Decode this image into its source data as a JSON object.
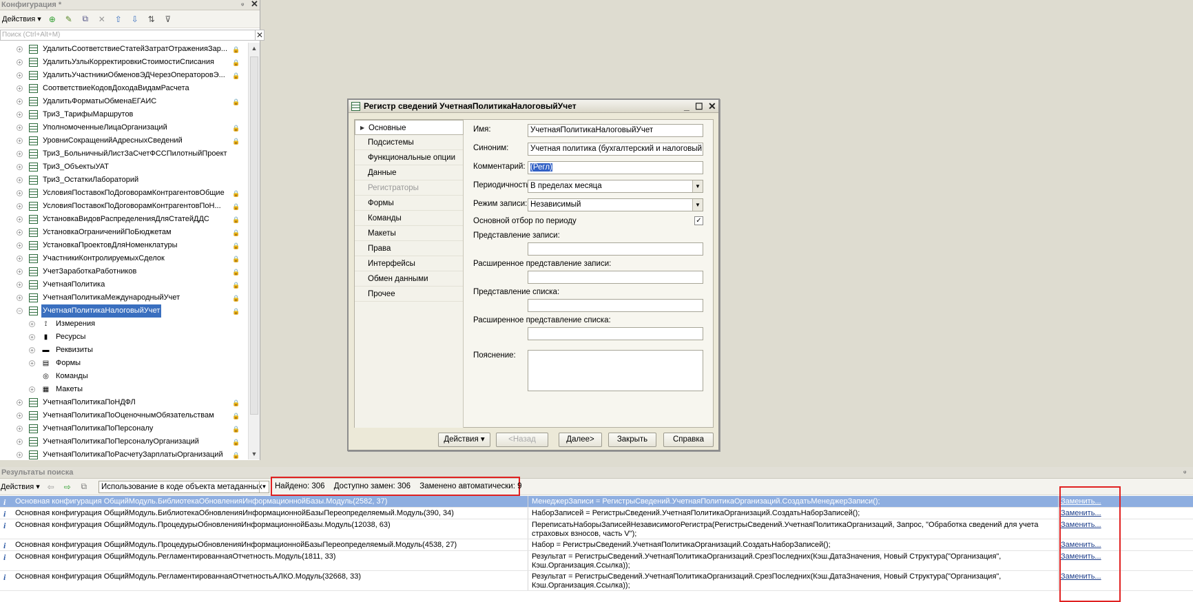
{
  "config": {
    "title": "Конфигурация *",
    "actions_label": "Действия",
    "search_placeholder": "Поиск (Ctrl+Alt+M)",
    "tree_items": [
      {
        "label": "УдалитьСоответствиеСтатейЗатратОтраженияЗар...",
        "lock": true
      },
      {
        "label": "УдалитьУзлыКорректировкиСтоимостиСписания",
        "lock": true
      },
      {
        "label": "УдалитьУчастникиОбменовЭДЧерезОператоровЭ...",
        "lock": true
      },
      {
        "label": "СоответствиеКодовДоходаВидамРасчета",
        "lock": false
      },
      {
        "label": "УдалитьФорматыОбменаЕГАИС",
        "lock": true
      },
      {
        "label": "ТриЗ_ТарифыМаршрутов",
        "lock": false
      },
      {
        "label": "УполномоченныеЛицаОрганизаций",
        "lock": true
      },
      {
        "label": "УровниСокращенийАдресныхСведений",
        "lock": true
      },
      {
        "label": "ТриЗ_БольничныйЛистЗаСчетФССПилотныйПроект",
        "lock": false
      },
      {
        "label": "ТриЗ_ОбъектыУАТ",
        "lock": false
      },
      {
        "label": "ТриЗ_ОстаткиЛабораторий",
        "lock": false
      },
      {
        "label": "УсловияПоставокПоДоговорамКонтрагентовОбщие",
        "lock": true
      },
      {
        "label": "УсловияПоставокПоДоговорамКонтрагентовПоН...",
        "lock": true
      },
      {
        "label": "УстановкаВидовРаспределенияДляСтатейДДС",
        "lock": true
      },
      {
        "label": "УстановкаОграниченийПоБюджетам",
        "lock": true
      },
      {
        "label": "УстановкаПроектовДляНоменклатуры",
        "lock": true
      },
      {
        "label": "УчастникиКонтролируемыхСделок",
        "lock": true
      },
      {
        "label": "УчетЗаработкаРаботников",
        "lock": true
      },
      {
        "label": "УчетнаяПолитика",
        "lock": true
      },
      {
        "label": "УчетнаяПолитикаМеждународныйУчет",
        "lock": true
      },
      {
        "label": "УчетнаяПолитикаНалоговыйУчет",
        "lock": true,
        "selected": true
      }
    ],
    "children": [
      {
        "label": "Измерения",
        "icon": "dimensions-icon",
        "glyph": "⟟"
      },
      {
        "label": "Ресурсы",
        "icon": "resources-icon",
        "glyph": "▮"
      },
      {
        "label": "Реквизиты",
        "icon": "attributes-icon",
        "glyph": "▬"
      },
      {
        "label": "Формы",
        "icon": "forms-icon",
        "glyph": "▤"
      },
      {
        "label": "Команды",
        "icon": "commands-icon",
        "glyph": "◎"
      },
      {
        "label": "Макеты",
        "icon": "layouts-icon",
        "glyph": "▦"
      }
    ],
    "tree_items_after": [
      {
        "label": "УчетнаяПолитикаПоНДФЛ",
        "lock": true
      },
      {
        "label": "УчетнаяПолитикаПоОценочнымОбязательствам",
        "lock": true
      },
      {
        "label": "УчетнаяПолитикаПоПерсоналу",
        "lock": true
      },
      {
        "label": "УчетнаяПолитикаПоПерсоналуОрганизаций",
        "lock": true
      },
      {
        "label": "УчетнаяПолитикаПоРасчетуЗарплатыОрганизаций",
        "lock": true
      }
    ]
  },
  "dialog": {
    "title": "Регистр сведений УчетнаяПолитикаНалоговыйУчет",
    "tabs": [
      {
        "label": "Основные",
        "active": true
      },
      {
        "label": "Подсистемы"
      },
      {
        "label": "Функциональные опции"
      },
      {
        "label": "Данные"
      },
      {
        "label": "Регистраторы",
        "disabled": true
      },
      {
        "label": "Формы"
      },
      {
        "label": "Команды"
      },
      {
        "label": "Макеты"
      },
      {
        "label": "Права"
      },
      {
        "label": "Интерфейсы"
      },
      {
        "label": "Обмен данными"
      },
      {
        "label": "Прочее"
      }
    ],
    "fields": {
      "name_label": "Имя:",
      "name_value": "УчетнаяПолитикаНалоговыйУчет",
      "synonym_label": "Синоним:",
      "synonym_value": "Учетная политика (бухгалтерский и налоговый уч",
      "comment_label": "Комментарий:",
      "comment_value": "(Регл)",
      "periodicity_label": "Периодичность:",
      "periodicity_value": "В пределах месяца",
      "write_mode_label": "Режим записи:",
      "write_mode_value": "Независимый",
      "main_filter_label": "Основной отбор по периоду",
      "record_repr_label": "Представление записи:",
      "ext_record_repr_label": "Расширенное представление записи:",
      "list_repr_label": "Представление списка:",
      "ext_list_repr_label": "Расширенное представление списка:",
      "explanation_label": "Пояснение:"
    },
    "buttons": {
      "actions": "Действия",
      "back": "<Назад",
      "next": "Далее>",
      "close": "Закрыть",
      "help": "Справка"
    }
  },
  "results": {
    "title": "Результаты поиска",
    "actions_label": "Действия",
    "filter_value": "Использование в коде объекта метаданных",
    "found": "Найдено: 306",
    "available": "Доступно замен: 306",
    "replaced": "Заменено автоматически: 9",
    "rows": [
      {
        "location": "Основная конфигурация ОбщийМодуль.БиблиотекаОбновленияИнформационнойБазы.Модуль(2582, 37)",
        "code": "МенеджерЗаписи = РегистрыСведений.УчетнаяПолитикаОрганизаций.СоздатьМенеджерЗаписи();",
        "action": "Заменить..."
      },
      {
        "location": "Основная конфигурация ОбщийМодуль.БиблиотекаОбновленияИнформационнойБазыПереопределяемый.Модуль(390, 34)",
        "code": "НаборЗаписей = РегистрыСведений.УчетнаяПолитикаОрганизаций.СоздатьНаборЗаписей();",
        "action": "Заменить..."
      },
      {
        "location": "Основная конфигурация ОбщийМодуль.ПроцедурыОбновленияИнформационнойБазы.Модуль(12038, 63)",
        "code": "ПереписатьНаборыЗаписейНезависимогоРегистра(РегистрыСведений.УчетнаяПолитикаОрганизаций, Запрос, \"Обработка сведений для учета страховых взносов, часть V\");",
        "action": "Заменить..."
      },
      {
        "location": "Основная конфигурация ОбщийМодуль.ПроцедурыОбновленияИнформационнойБазыПереопределяемый.Модуль(4538, 27)",
        "code": "Набор = РегистрыСведений.УчетнаяПолитикаОрганизаций.СоздатьНаборЗаписей();",
        "action": "Заменить..."
      },
      {
        "location": "Основная конфигурация ОбщийМодуль.РегламентированнаяОтчетность.Модуль(1811, 33)",
        "code": "Результат = РегистрыСведений.УчетнаяПолитикаОрганизаций.СрезПоследних(Кэш.ДатаЗначения, Новый Структура(\"Организация\", Кэш.Организация.Ссылка));",
        "action": "Заменить..."
      },
      {
        "location": "Основная конфигурация ОбщийМодуль.РегламентированнаяОтчетностьАЛКО.Модуль(32668, 33)",
        "code": "Результат = РегистрыСведений.УчетнаяПолитикаОрганизаций.СрезПоследних(Кэш.ДатаЗначения, Новый Структура(\"Организация\", Кэш.Организация.Ссылка));",
        "action": "Заменить..."
      }
    ]
  }
}
